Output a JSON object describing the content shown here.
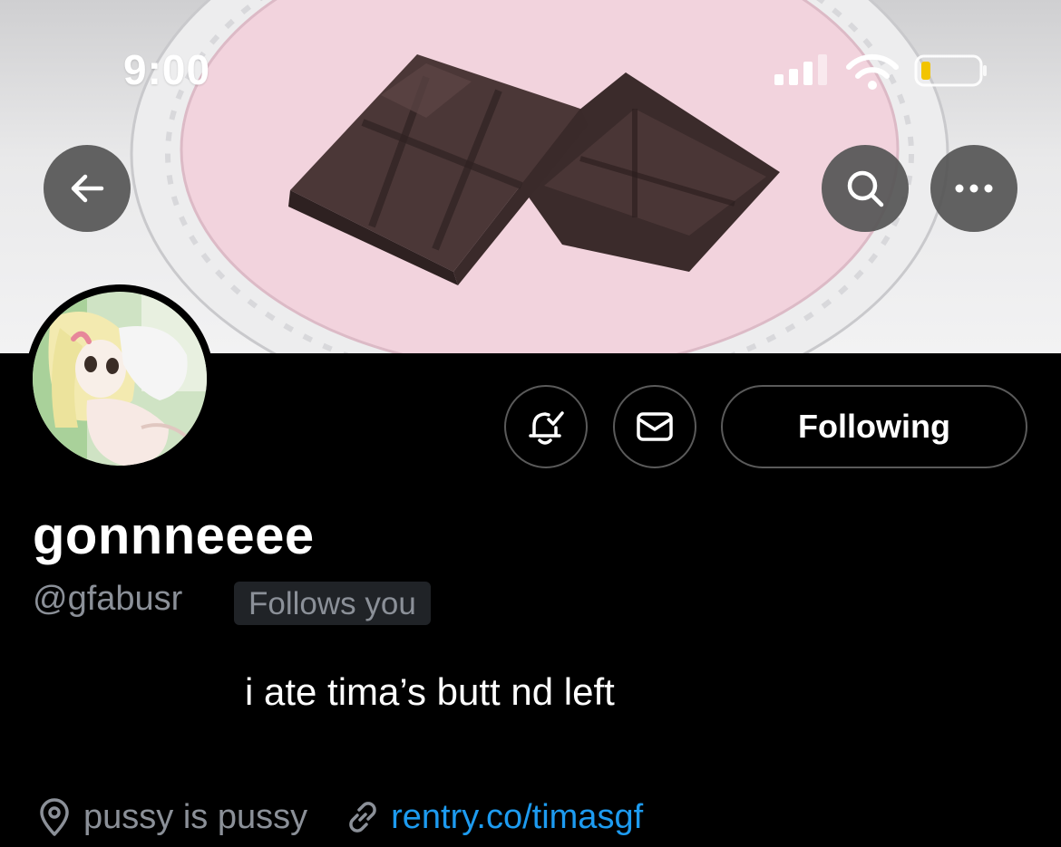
{
  "status_bar": {
    "time": "9:00"
  },
  "banner": {
    "description_icon": "chocolate-bar-image"
  },
  "profile": {
    "display_name": "gonnneeee",
    "handle": "@gfabusr",
    "follows_you_badge": "Follows you",
    "bio": "i ate tima’s butt nd left",
    "location": "pussy is pussy",
    "link": "rentry.co/timasgf"
  },
  "actions": {
    "following_label": "Following"
  },
  "icons": {
    "back": "arrow-left-icon",
    "search": "search-icon",
    "more": "more-dots-icon",
    "notify": "bell-check-icon",
    "message": "envelope-icon",
    "location": "location-pin-icon",
    "link": "link-icon"
  },
  "colors": {
    "background": "#000000",
    "secondary_text": "#8b9098",
    "link": "#1d9bf0",
    "badge_bg": "#202327",
    "button_border": "#5a5a5a"
  }
}
